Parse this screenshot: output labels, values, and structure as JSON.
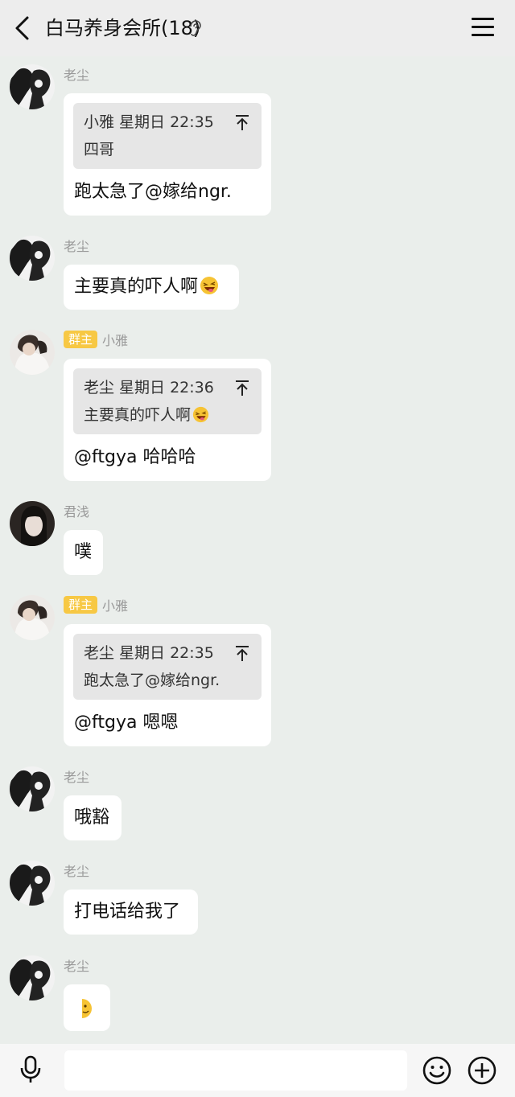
{
  "header": {
    "title": "白马养身会所(18)",
    "back_icon": "chevron-left-icon",
    "ear_icon": "ear-icon",
    "menu_icon": "hamburger-menu-icon"
  },
  "messages": [
    {
      "sender": "老尘",
      "quote_header": "小雅 星期日 22:35",
      "quote_text": "四哥",
      "text": "跑太急了@嫁给ngr."
    },
    {
      "sender": "老尘",
      "text": "主要真的吓人啊",
      "emoji": "laughing-emoji"
    },
    {
      "sender": "小雅",
      "badge": "群主",
      "quote_header": "老尘 星期日 22:36",
      "quote_text": "主要真的吓人啊",
      "quote_emoji": "laughing-emoji",
      "text": "@ftgya 哈哈哈"
    },
    {
      "sender": "君浅",
      "text": "噗"
    },
    {
      "sender": "小雅",
      "badge": "群主",
      "quote_header": "老尘 星期日 22:35",
      "quote_text": "跑太急了@嫁给ngr.",
      "text": "@ftgya 嗯嗯"
    },
    {
      "sender": "老尘",
      "text": "哦豁"
    },
    {
      "sender": "老尘",
      "text": "打电话给我了"
    },
    {
      "sender": "老尘",
      "emoji": "half-face-emoji"
    }
  ],
  "input_bar": {
    "mic_icon": "microphone-icon",
    "emoji_icon": "smiley-icon",
    "plus_icon": "plus-circle-icon",
    "input_value": ""
  },
  "colors": {
    "chat_bg": "#eaeeeb",
    "badge": "#f7c844",
    "bubble": "#ffffff",
    "quote_bg": "#e6e6e6"
  }
}
